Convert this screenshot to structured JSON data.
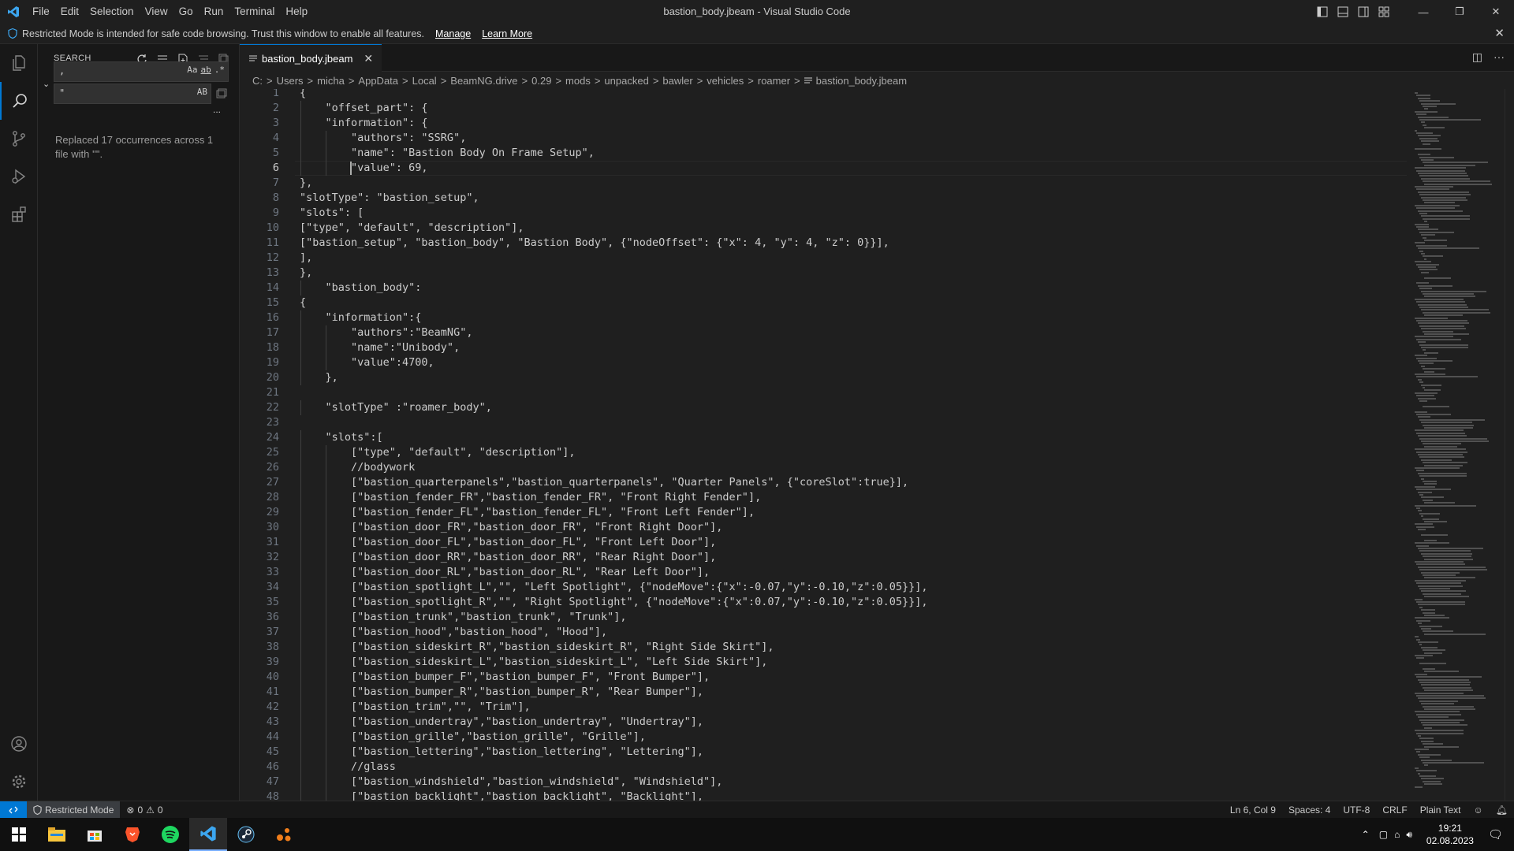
{
  "window": {
    "title": "bastion_body.jbeam - Visual Studio Code",
    "controls": {
      "minimize": "—",
      "restore": "❐",
      "close": "✕"
    }
  },
  "menu": [
    "File",
    "Edit",
    "Selection",
    "View",
    "Go",
    "Run",
    "Terminal",
    "Help"
  ],
  "banner": {
    "text": "Restricted Mode is intended for safe code browsing. Trust this window to enable all features.",
    "manage": "Manage",
    "learn_more": "Learn More",
    "close": "✕"
  },
  "sidebar": {
    "title": "SEARCH",
    "search_value": ",",
    "replace_value": "\"",
    "opt_case": "Aa",
    "opt_word": "ab",
    "opt_regex": ".*",
    "opt_preserve": "AB",
    "more": "...",
    "result_message": "Replaced 17 occurrences across 1 file with '\"'."
  },
  "tab": {
    "label": "bastion_body.jbeam",
    "close": "✕"
  },
  "tab_actions": {
    "split": "◫",
    "more": "···"
  },
  "breadcrumb": [
    "C:",
    "Users",
    "micha",
    "AppData",
    "Local",
    "BeamNG.drive",
    "0.29",
    "mods",
    "unpacked",
    "bawler",
    "vehicles",
    "roamer",
    "bastion_body.jbeam"
  ],
  "breadcrumb_sep": ">",
  "editor": {
    "current_line": 6,
    "lines": [
      "{",
      "    \"offset_part\": {",
      "    \"information\": {",
      "        \"authors\": \"SSRG\",",
      "        \"name\": \"Bastion Body On Frame Setup\",",
      "        \"value\": 69,",
      "},",
      "\"slotType\": \"bastion_setup\",",
      "\"slots\": [",
      "[\"type\", \"default\", \"description\"],",
      "[\"bastion_setup\", \"bastion_body\", \"Bastion Body\", {\"nodeOffset\": {\"x\": 4, \"y\": 4, \"z\": 0}}],",
      "],",
      "},",
      "    \"bastion_body\":",
      "{",
      "    \"information\":{",
      "        \"authors\":\"BeamNG\",",
      "        \"name\":\"Unibody\",",
      "        \"value\":4700,",
      "    },",
      "",
      "    \"slotType\" :\"roamer_body\",",
      "",
      "    \"slots\":[",
      "        [\"type\", \"default\", \"description\"],",
      "        //bodywork",
      "        [\"bastion_quarterpanels\",\"bastion_quarterpanels\", \"Quarter Panels\", {\"coreSlot\":true}],",
      "        [\"bastion_fender_FR\",\"bastion_fender_FR\", \"Front Right Fender\"],",
      "        [\"bastion_fender_FL\",\"bastion_fender_FL\", \"Front Left Fender\"],",
      "        [\"bastion_door_FR\",\"bastion_door_FR\", \"Front Right Door\"],",
      "        [\"bastion_door_FL\",\"bastion_door_FL\", \"Front Left Door\"],",
      "        [\"bastion_door_RR\",\"bastion_door_RR\", \"Rear Right Door\"],",
      "        [\"bastion_door_RL\",\"bastion_door_RL\", \"Rear Left Door\"],",
      "        [\"bastion_spotlight_L\",\"\", \"Left Spotlight\", {\"nodeMove\":{\"x\":-0.07,\"y\":-0.10,\"z\":0.05}}],",
      "        [\"bastion_spotlight_R\",\"\", \"Right Spotlight\", {\"nodeMove\":{\"x\":0.07,\"y\":-0.10,\"z\":0.05}}],",
      "        [\"bastion_trunk\",\"bastion_trunk\", \"Trunk\"],",
      "        [\"bastion_hood\",\"bastion_hood\", \"Hood\"],",
      "        [\"bastion_sideskirt_R\",\"bastion_sideskirt_R\", \"Right Side Skirt\"],",
      "        [\"bastion_sideskirt_L\",\"bastion_sideskirt_L\", \"Left Side Skirt\"],",
      "        [\"bastion_bumper_F\",\"bastion_bumper_F\", \"Front Bumper\"],",
      "        [\"bastion_bumper_R\",\"bastion_bumper_R\", \"Rear Bumper\"],",
      "        [\"bastion_trim\",\"\", \"Trim\"],",
      "        [\"bastion_undertray\",\"bastion_undertray\", \"Undertray\"],",
      "        [\"bastion_grille\",\"bastion_grille\", \"Grille\"],",
      "        [\"bastion_lettering\",\"bastion_lettering\", \"Lettering\"],",
      "        //glass",
      "        [\"bastion_windshield\",\"bastion_windshield\", \"Windshield\"],",
      "        [\"bastion_backlight\",\"bastion_backlight\", \"Backlight\"],"
    ]
  },
  "status": {
    "restricted": "Restricted Mode",
    "errors": "0",
    "warnings": "0",
    "position": "Ln 6, Col 9",
    "spaces": "Spaces: 4",
    "encoding": "UTF-8",
    "eol": "CRLF",
    "language": "Plain Text"
  },
  "taskbar": {
    "time": "19:21",
    "date": "02.08.2023"
  },
  "colors": {
    "accent": "#0078d4",
    "editor_bg": "#1f1f1f",
    "sidebar_bg": "#181818"
  }
}
